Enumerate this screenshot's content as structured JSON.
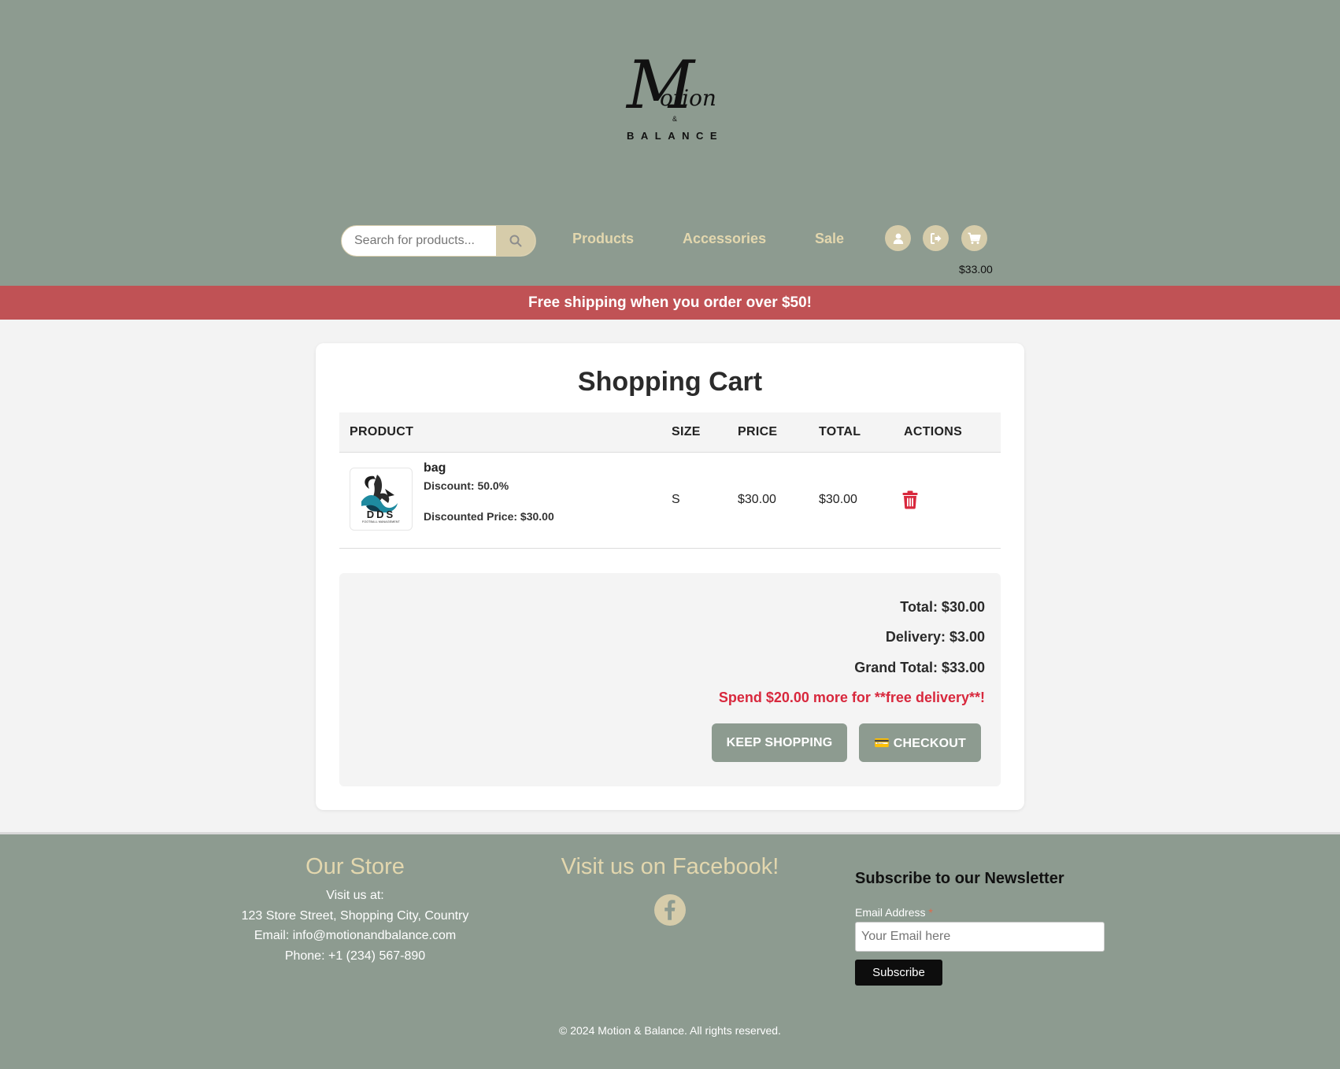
{
  "header": {
    "logo": {
      "script_text": "Motion",
      "amp": "&",
      "balance": "BALANCE"
    },
    "search": {
      "placeholder": "Search for products..."
    },
    "nav": [
      {
        "label": "Products"
      },
      {
        "label": "Accessories"
      },
      {
        "label": "Sale"
      }
    ],
    "icons": [
      "user-icon",
      "logout-icon",
      "cart-icon"
    ],
    "cart_amount": "$33.00"
  },
  "promo": {
    "text": "Free shipping when you order over $50!"
  },
  "cart": {
    "title": "Shopping Cart",
    "columns": [
      "PRODUCT",
      "SIZE",
      "PRICE",
      "TOTAL",
      "ACTIONS"
    ],
    "items": [
      {
        "name": "bag",
        "discount": "Discount: 50.0%",
        "discounted_price": "Discounted Price: $30.00",
        "size": "S",
        "price": "$30.00",
        "total": "$30.00",
        "thumb_text": "DDS",
        "thumb_subtext": "FOOTBALL MANAGEMENT"
      }
    ],
    "summary": {
      "total": "Total: $30.00",
      "delivery": "Delivery: $3.00",
      "grand_total": "Grand Total: $33.00",
      "spend_more": "Spend $20.00 more for **free delivery**!"
    },
    "buttons": {
      "keep_shopping": "KEEP SHOPPING",
      "checkout": "💳 CHECKOUT"
    }
  },
  "footer": {
    "store_title": "Our Store",
    "store_lines": [
      "Visit us at:",
      "123 Store Street, Shopping City, Country",
      "Email: info@motionandbalance.com",
      "Phone: +1 (234) 567-890"
    ],
    "facebook_title": "Visit us on Facebook!",
    "newsletter": {
      "title": "Subscribe to our Newsletter",
      "label": "Email Address",
      "required_mark": "*",
      "placeholder": "Your Email here",
      "button": "Subscribe"
    },
    "copyright": "© 2024 Motion & Balance. All rights reserved."
  },
  "colors": {
    "header_bg": "#8d9b90",
    "accent": "#d6ccaa",
    "promo_bg": "#c05255",
    "danger": "#d8283d"
  }
}
